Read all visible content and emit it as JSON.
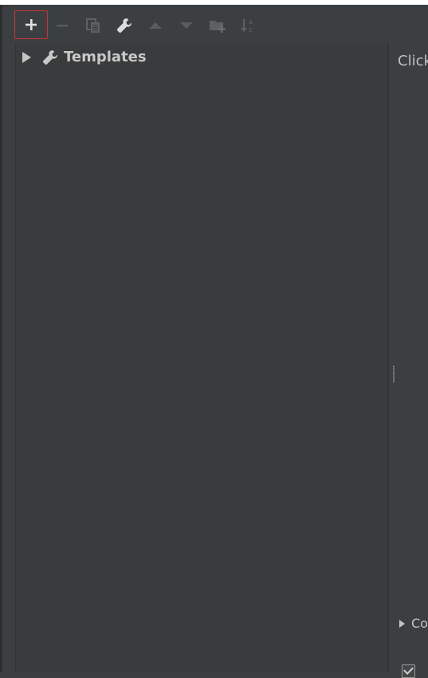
{
  "toolbar": {
    "buttons": [
      {
        "id": "add",
        "icon": "plus-icon",
        "enabled": true,
        "selected": true
      },
      {
        "id": "remove",
        "icon": "minus-icon",
        "enabled": false
      },
      {
        "id": "copy",
        "icon": "copy-icon",
        "enabled": false
      },
      {
        "id": "edit",
        "icon": "wrench-icon",
        "enabled": true
      },
      {
        "id": "move-up",
        "icon": "arrow-up-icon",
        "enabled": false
      },
      {
        "id": "move-down",
        "icon": "arrow-down-icon",
        "enabled": false
      },
      {
        "id": "new-group",
        "icon": "new-folder-icon",
        "enabled": false
      },
      {
        "id": "sort",
        "icon": "sort-alpha-icon",
        "enabled": false
      }
    ]
  },
  "tree": {
    "root": {
      "label": "Templates",
      "icon": "wrench-icon",
      "expanded": false
    }
  },
  "right_panel": {
    "hint_text": "Click",
    "collapsible_label": "Co",
    "checkbox_checked": true
  },
  "colors": {
    "background": "#3c3f41",
    "tree_background": "#393b3d",
    "selection_border": "#c8353a",
    "text": "#c8c8c8"
  }
}
